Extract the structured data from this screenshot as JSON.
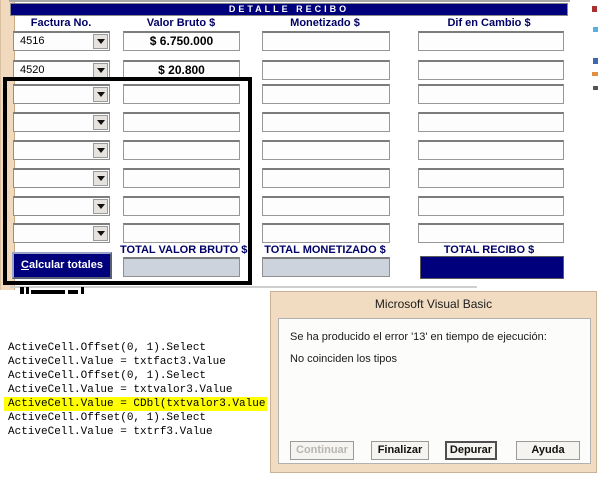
{
  "form": {
    "title": "DETALLE RECIBO",
    "columns": {
      "factura": "Factura No.",
      "valor_bruto": "Valor Bruto $",
      "monetizado": "Monetizado $",
      "dif_en_cambio": "Dif en Cambio $"
    },
    "rows": [
      {
        "factura": "4516",
        "valor_bruto": "$ 6.750.000",
        "monetizado": "",
        "dif_en_cambio": ""
      },
      {
        "factura": "4520",
        "valor_bruto": "$ 20.800",
        "monetizado": "",
        "dif_en_cambio": ""
      },
      {
        "factura": "",
        "valor_bruto": "",
        "monetizado": "",
        "dif_en_cambio": ""
      },
      {
        "factura": "",
        "valor_bruto": "",
        "monetizado": "",
        "dif_en_cambio": ""
      },
      {
        "factura": "",
        "valor_bruto": "",
        "monetizado": "",
        "dif_en_cambio": ""
      },
      {
        "factura": "",
        "valor_bruto": "",
        "monetizado": "",
        "dif_en_cambio": ""
      },
      {
        "factura": "",
        "valor_bruto": "",
        "monetizado": "",
        "dif_en_cambio": ""
      },
      {
        "factura": "",
        "valor_bruto": "",
        "monetizado": "",
        "dif_en_cambio": ""
      }
    ],
    "totals": {
      "calc_button_label": "Calcular totales",
      "total_valor_bruto_label": "TOTAL VALOR BRUTO $",
      "total_monetizado_label": "TOTAL MONETIZADO $",
      "total_recibo_label": "TOTAL RECIBO $",
      "total_valor_bruto_value": "",
      "total_monetizado_value": "",
      "total_recibo_value": ""
    }
  },
  "code": {
    "lines": [
      {
        "text": "ActiveCell.Offset(0, 1).Select",
        "highlighted": false
      },
      {
        "text": "ActiveCell.Value = txtfact3.Value",
        "highlighted": false
      },
      {
        "text": "ActiveCell.Offset(0, 1).Select",
        "highlighted": false
      },
      {
        "text": "ActiveCell.Value = txtvalor3.Value",
        "highlighted": false
      },
      {
        "text": "ActiveCell.Value = CDbl(txtvalor3.Value",
        "highlighted": true
      },
      {
        "text": "ActiveCell.Offset(0, 1).Select",
        "highlighted": false
      },
      {
        "text": "ActiveCell.Value = txtrf3.Value",
        "highlighted": false
      }
    ]
  },
  "dialog": {
    "title": "Microsoft Visual Basic",
    "message_line1": "Se ha producido el error '13' en tiempo de ejecución:",
    "message_line2": "No coinciden los tipos",
    "buttons": [
      {
        "label": "Continuar",
        "enabled": false,
        "default": false
      },
      {
        "label": "Finalizar",
        "enabled": true,
        "default": false
      },
      {
        "label": "Depurar",
        "enabled": true,
        "default": true
      },
      {
        "label": "Ayuda",
        "enabled": true,
        "default": false
      }
    ]
  },
  "colors": {
    "navy": "#00007d",
    "peach_border": "#f0d9bd",
    "highlight_yellow": "#ffff00",
    "total_box_gray": "#ccd3dd",
    "label_navy": "#000066"
  }
}
